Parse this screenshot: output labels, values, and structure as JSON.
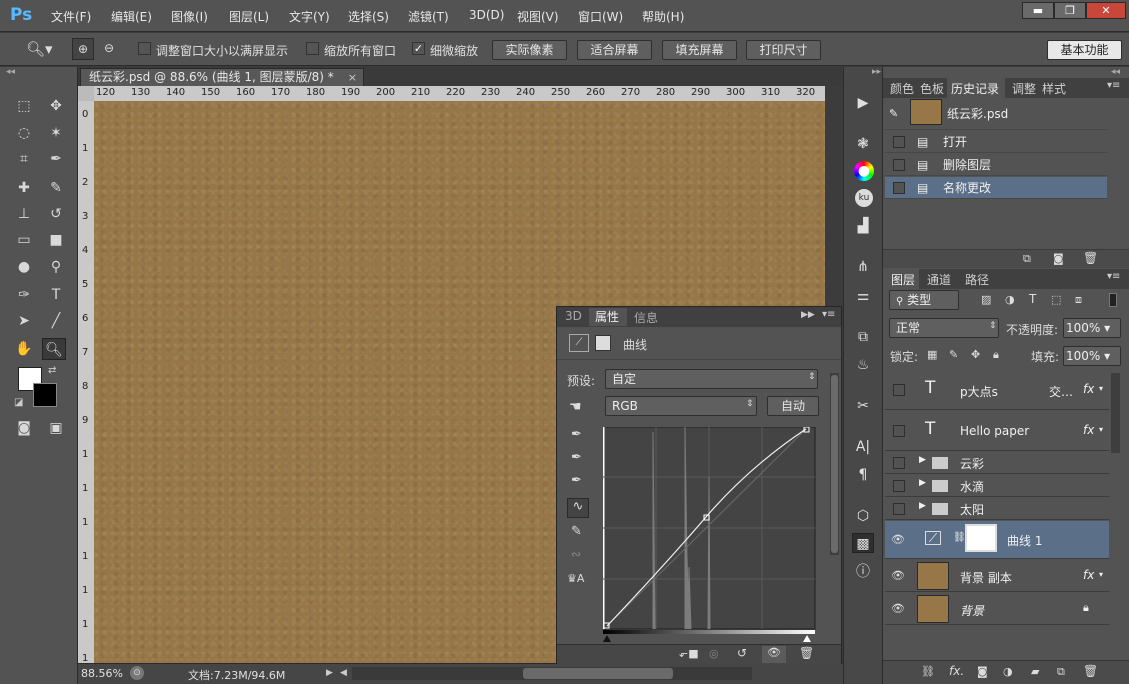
{
  "app": {
    "logo": "Ps"
  },
  "menu": [
    "文件(F)",
    "编辑(E)",
    "图像(I)",
    "图层(L)",
    "文字(Y)",
    "选择(S)",
    "滤镜(T)",
    "3D(D)",
    "视图(V)",
    "窗口(W)",
    "帮助(H)"
  ],
  "window_controls": {
    "minimize": "▬",
    "restore": "❐",
    "close": "✕"
  },
  "options": {
    "resize_windows_label": "调整窗口大小以满屏显示",
    "zoom_all_label": "缩放所有窗口",
    "scrubby_zoom_label": "细微缩放",
    "actual_pixels": "实际像素",
    "fit_screen": "适合屏幕",
    "fill_screen": "填充屏幕",
    "print_size": "打印尺寸",
    "workspace": "基本功能"
  },
  "document": {
    "tab_title": "纸云彩.psd @ 88.6% (曲线 1, 图层蒙版/8) *",
    "ruler_ticks": [
      "120",
      "130",
      "140",
      "150",
      "160",
      "170",
      "180",
      "190",
      "200",
      "210",
      "220",
      "230",
      "240",
      "250",
      "260",
      "270",
      "280",
      "290",
      "300",
      "310",
      "320"
    ],
    "vruler_ticks": [
      "0",
      "1",
      "2",
      "3",
      "4",
      "5",
      "6",
      "7",
      "8",
      "9",
      "1",
      "1",
      "1",
      "1",
      "1",
      "1",
      "1"
    ]
  },
  "status": {
    "zoom": "88.56%",
    "doc_size": "文档:7.23M/94.6M"
  },
  "properties": {
    "tabs": [
      "3D",
      "属性",
      "信息"
    ],
    "active_tab": "属性",
    "adjustment_name": "曲线",
    "preset_label": "预设:",
    "preset_value": "自定",
    "channel_value": "RGB",
    "auto_button": "自动"
  },
  "history_panel": {
    "tabs": [
      "颜色",
      "色板",
      "历史记录",
      "调整",
      "样式"
    ],
    "active_tab": "历史记录",
    "snapshot": "纸云彩.psd",
    "items": [
      "打开",
      "删除图层",
      "名称更改"
    ]
  },
  "layers_panel": {
    "tabs": [
      "图层",
      "通道",
      "路径"
    ],
    "filter_label": "类型",
    "blend_mode": "正常",
    "opacity_label": "不透明度:",
    "opacity_value": "100%",
    "lock_label": "锁定:",
    "fill_label": "填充:",
    "fill_value": "100%",
    "layers": [
      {
        "name": "p大点s",
        "extra": "交…",
        "type": "text"
      },
      {
        "name": "Hello paper",
        "type": "text"
      },
      {
        "name": "云彩",
        "type": "group"
      },
      {
        "name": "水滴",
        "type": "group"
      },
      {
        "name": "太阳",
        "type": "group"
      },
      {
        "name": "曲线 1",
        "type": "adjustment"
      },
      {
        "name": "背景 副本",
        "type": "pixel"
      },
      {
        "name": "背景",
        "type": "background"
      }
    ]
  },
  "colors": {
    "canvas": "#977748",
    "selected_row": "#5b6f88",
    "ps_blue": "#59b8ff"
  }
}
